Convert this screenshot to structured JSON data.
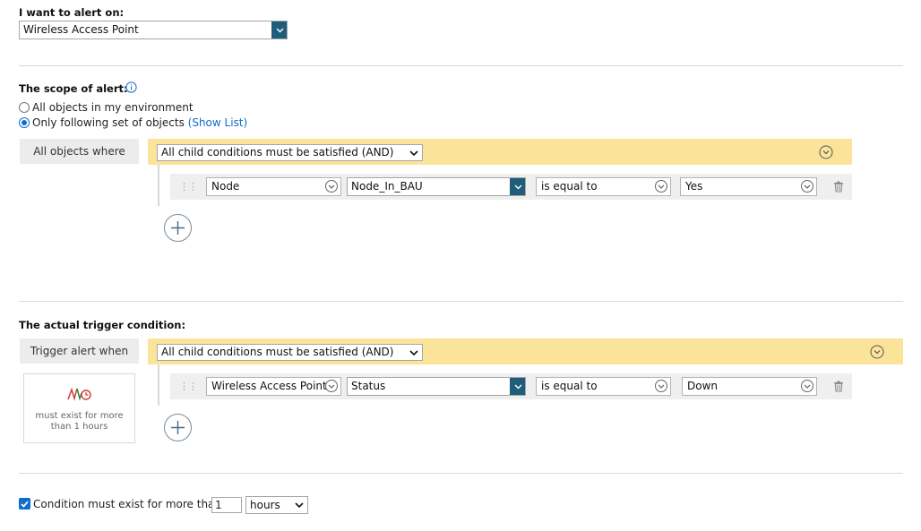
{
  "alert_on": {
    "label": "I want to alert on:",
    "value": "Wireless Access Point"
  },
  "scope": {
    "label": "The scope of alert:",
    "option_all": "All objects in my environment",
    "option_following": "Only following set of objects",
    "show_list": "(Show List)",
    "selected": "Only following set of objects",
    "where_label": "All objects where",
    "group_value": "All child conditions must be satisfied (AND)",
    "condition": {
      "object": "Node",
      "field": "Node_In_BAU",
      "operator": "is equal to",
      "value": "Yes"
    }
  },
  "trigger": {
    "label": "The actual trigger condition:",
    "when_label": "Trigger alert when",
    "group_value": "All child conditions must be satisfied (AND)",
    "card_text_line1": "must exist for more",
    "card_text_line2": "than 1 hours",
    "condition": {
      "object": "Wireless Access Point",
      "field": "Status",
      "operator": "is equal to",
      "value": "Down"
    }
  },
  "footer": {
    "checkbox_label": "Condition must exist for more than",
    "checked": true,
    "amount": "1",
    "unit": "hours"
  },
  "colors": {
    "accent_blue": "#1f5e7a",
    "link_blue": "#0f6ecd",
    "group_yellow": "#fbe49a"
  }
}
